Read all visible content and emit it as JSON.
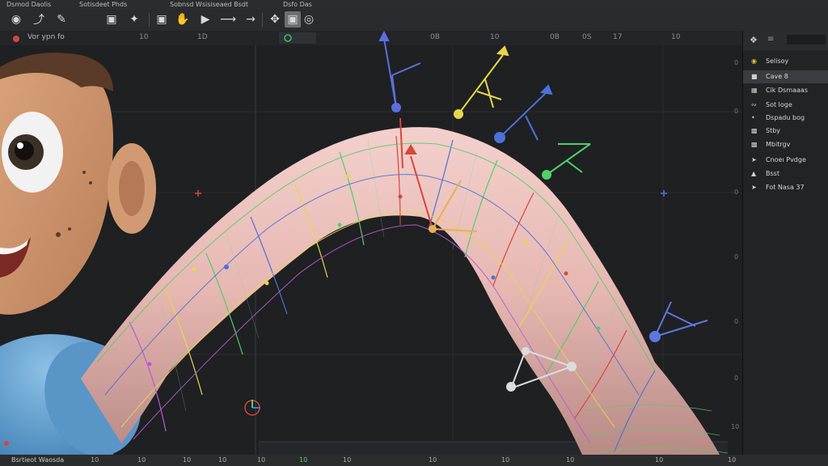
{
  "app": {
    "menu": [
      "Dsmod Daolis",
      "Sotisdeet Phds",
      "Sobnsd Wsisiseaed Bsdt",
      "Dsfo Das"
    ]
  },
  "toolbar": {
    "icons": [
      "select-icon",
      "move-icon",
      "brush-icon",
      "weight-paint-icon",
      "crop-icon",
      "joint-icon",
      "bone-icon",
      "rotate-icon",
      "cursor-icon",
      "add-icon"
    ]
  },
  "viewport": {
    "header_label": "Vor ypn fo",
    "ruler_marks": [
      "10",
      "1D",
      "0B",
      "10",
      "0B",
      "0S",
      "17",
      "10"
    ],
    "y_marks": [
      "0",
      "0",
      "0",
      "0",
      "0",
      "0",
      "10"
    ]
  },
  "right_panel": {
    "header_icon": "walk-icon",
    "items": [
      {
        "icon": "circle-icon",
        "label": "Selisoy"
      },
      {
        "icon": "square-icon",
        "label": "Cave 8"
      },
      {
        "icon": "grid-icon",
        "label": "Cik Dsmaaas"
      },
      {
        "icon": "bone-icon",
        "label": "Sot loge"
      },
      {
        "icon": "dot-icon",
        "label": "Dspadu bog"
      },
      {
        "icon": "cube-icon",
        "label": "Stby"
      },
      {
        "icon": "cube-icon",
        "label": "Mbitrgv"
      },
      {
        "icon": "cursor-icon",
        "label": "Cnoeı Pvdge"
      },
      {
        "icon": "joint-icon",
        "label": "Bsst"
      },
      {
        "icon": "move-icon",
        "label": "Fot Nasa 37"
      }
    ]
  },
  "statusbar": {
    "left": "Bsrtieot Waosda",
    "marks": [
      "10",
      "10",
      "10",
      "10",
      "10",
      "10",
      "10",
      "10",
      "10",
      "10",
      "10",
      "10"
    ]
  },
  "colors": {
    "mesh_yellow": "#e8d64a",
    "mesh_green": "#4fd068",
    "mesh_blue": "#4a72d8",
    "mesh_red": "#d8463a",
    "mesh_purple": "#b85ad8",
    "skin": "#e8b8b8",
    "shirt": "#6fa8d8"
  }
}
